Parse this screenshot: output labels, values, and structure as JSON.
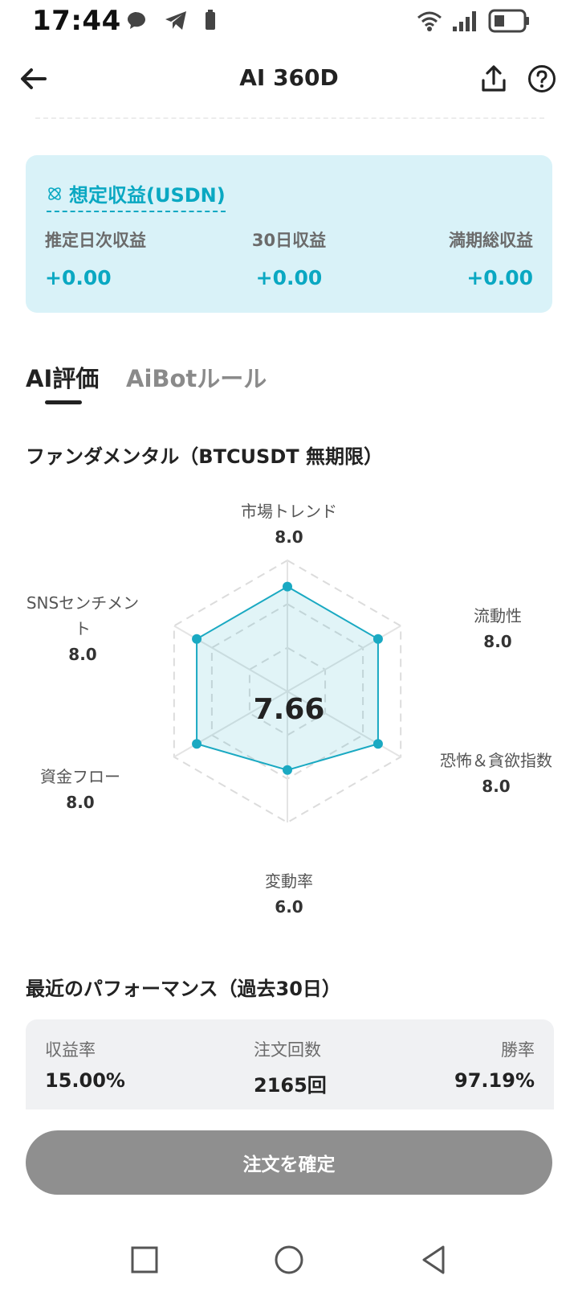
{
  "status_bar": {
    "time": "17:44"
  },
  "header": {
    "title": "AI 360D"
  },
  "income": {
    "title": "想定収益(USDN)",
    "columns": [
      {
        "label": "推定日次収益",
        "value": "+0.00"
      },
      {
        "label": "30日収益",
        "value": "+0.00"
      },
      {
        "label": "満期総収益",
        "value": "+0.00"
      }
    ]
  },
  "tabs": [
    {
      "label": "AI評価",
      "active": true
    },
    {
      "label": "AiBotルール",
      "active": false
    }
  ],
  "fundamental": {
    "title": "ファンダメンタル（BTCUSDT 無期限）",
    "score": "7.66",
    "scale_max": 10,
    "metrics": [
      {
        "label": "市場トレンド",
        "value": "8.0"
      },
      {
        "label": "流動性",
        "value": "8.0"
      },
      {
        "label": "恐怖＆貪欲指数",
        "value": "8.0"
      },
      {
        "label": "変動率",
        "value": "6.0"
      },
      {
        "label": "資金フロー",
        "value": "8.0"
      },
      {
        "label": "SNSセンチメント",
        "value": "8.0"
      }
    ],
    "accent_color": "#1aa9c2"
  },
  "performance": {
    "title": "最近のパフォーマンス（過去30日）",
    "columns": [
      {
        "label": "収益率",
        "value": "15.00%"
      },
      {
        "label": "注文回数",
        "value": "2165回"
      },
      {
        "label": "勝率",
        "value": "97.19%"
      }
    ]
  },
  "footer": {
    "confirm_label": "注文を確定"
  },
  "colors": {
    "accent": "#0aa8c2",
    "card_bg": "#d9f2f8",
    "button_disabled": "#8f8f8f"
  }
}
